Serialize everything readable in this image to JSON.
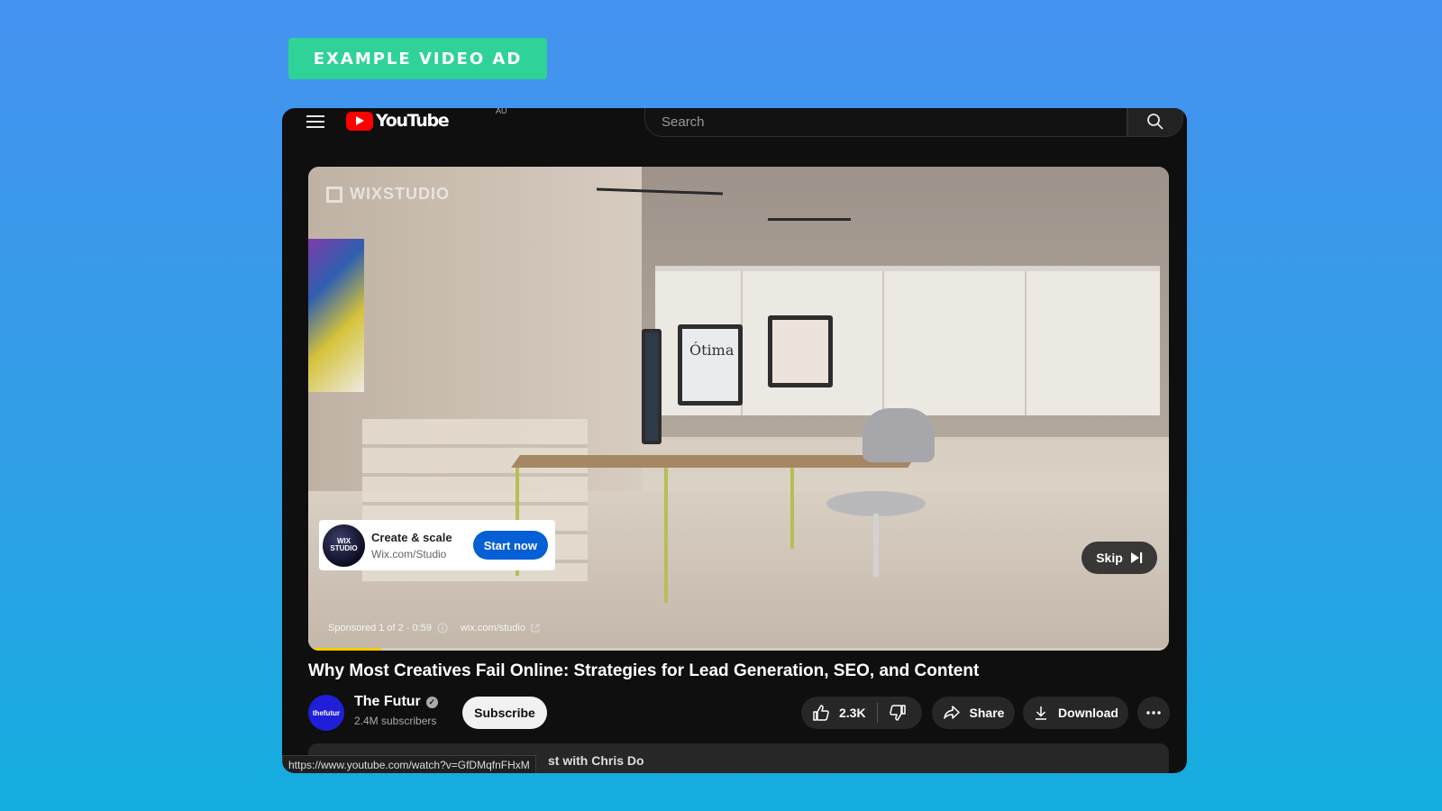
{
  "banner": {
    "label": "EXAMPLE VIDEO AD"
  },
  "topbar": {
    "logo_text": "YouTube",
    "country_code": "AU",
    "search_placeholder": "Search"
  },
  "video": {
    "watermark": "WIXSTUDIO",
    "ad_card": {
      "avatar_text": "WIX STUDIO",
      "title": "Create & scale",
      "url": "Wix.com/Studio",
      "cta": "Start now"
    },
    "skip_label": "Skip",
    "sponsored_text": "Sponsored 1 of 2 · 0:59",
    "advertiser_link": "wix.com/studio",
    "ad_progress_percent": 8.5,
    "progress_color": "#ffcc00"
  },
  "meta": {
    "title": "Why Most Creatives Fail Online: Strategies for Lead Generation, SEO, and Content",
    "channel": {
      "avatar_text": "thefutur",
      "name": "The Futur",
      "subscribers": "2.4M subscribers"
    },
    "subscribe_label": "Subscribe",
    "like_count": "2.3K",
    "share_label": "Share",
    "download_label": "Download",
    "description_snippet": "st with Chris Do"
  },
  "status_bar": {
    "url": "https://www.youtube.com/watch?v=GfDMqfnFHxM"
  },
  "colors": {
    "brand_red": "#ff0000",
    "cta_blue": "#065fd4",
    "banner_green": "#2fd398"
  }
}
